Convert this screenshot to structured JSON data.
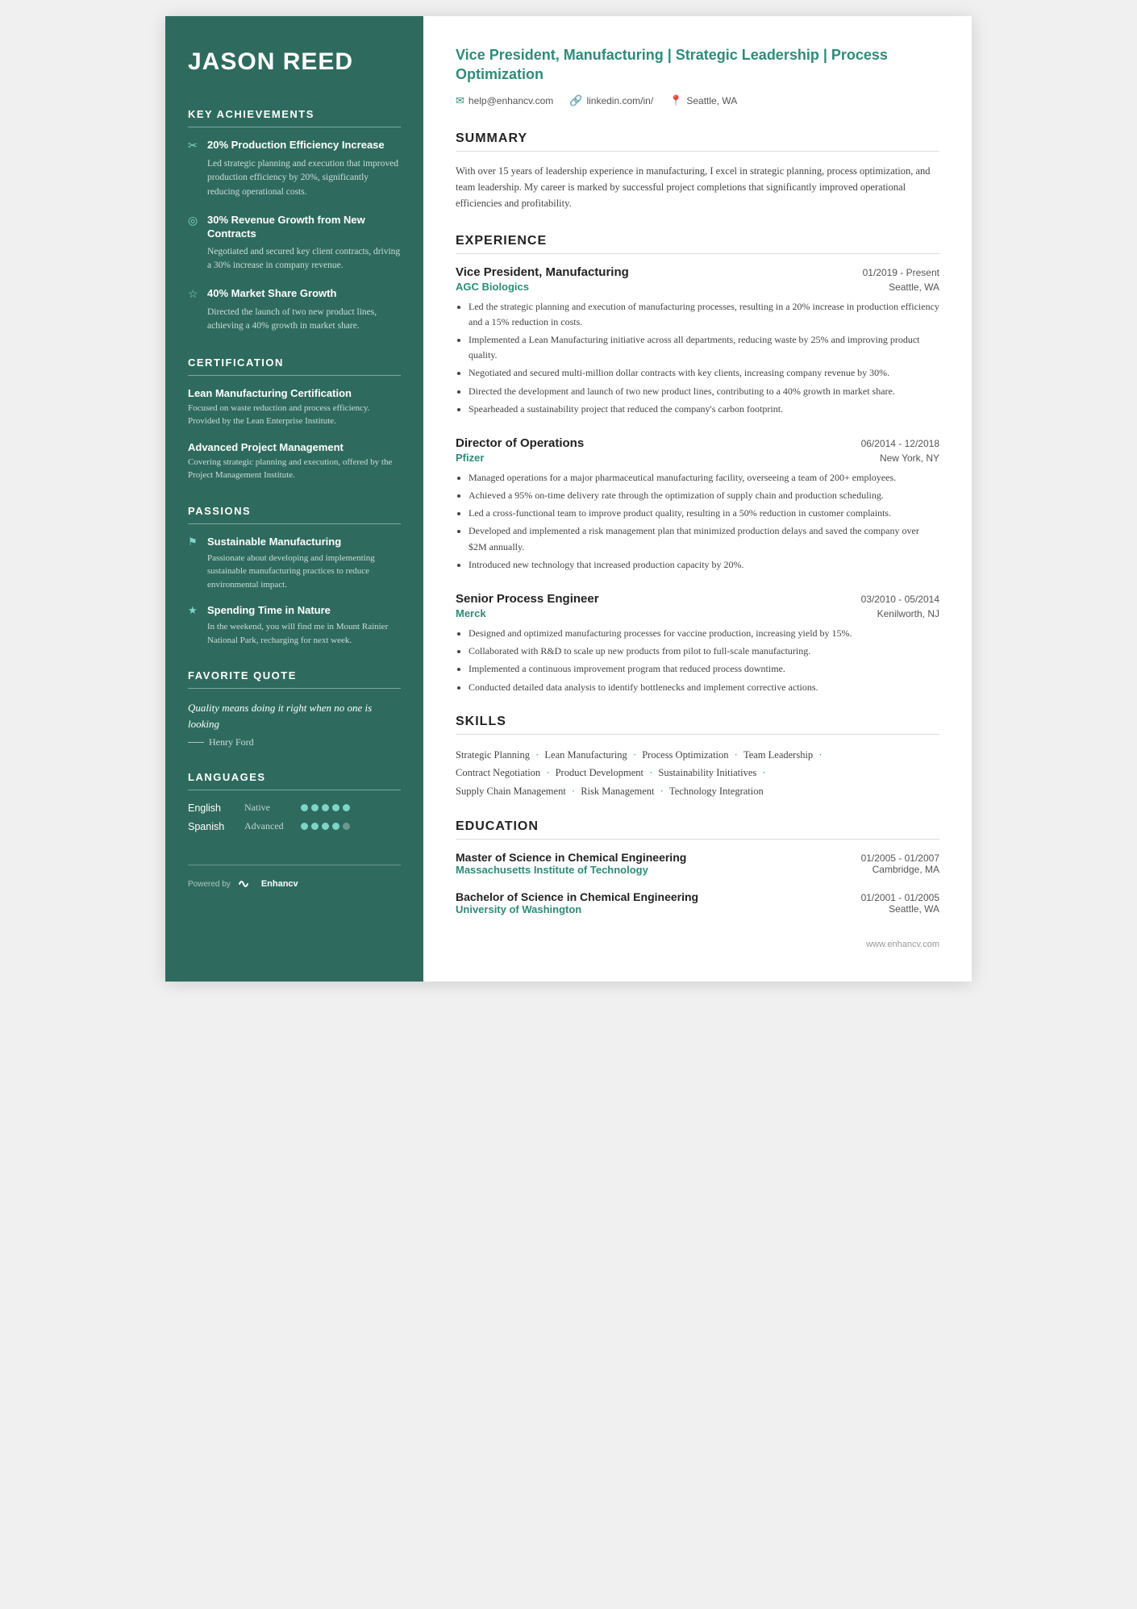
{
  "sidebar": {
    "name": "JASON REED",
    "sections": {
      "achievements_title": "KEY ACHIEVEMENTS",
      "achievements": [
        {
          "icon": "✂",
          "title": "20% Production Efficiency Increase",
          "desc": "Led strategic planning and execution that improved production efficiency by 20%, significantly reducing operational costs."
        },
        {
          "icon": "◎",
          "title": "30% Revenue Growth from New Contracts",
          "desc": "Negotiated and secured key client contracts, driving a 30% increase in company revenue."
        },
        {
          "icon": "☆",
          "title": "40% Market Share Growth",
          "desc": "Directed the launch of two new product lines, achieving a 40% growth in market share."
        }
      ],
      "certification_title": "CERTIFICATION",
      "certifications": [
        {
          "title": "Lean Manufacturing Certification",
          "desc": "Focused on waste reduction and process efficiency. Provided by the Lean Enterprise Institute."
        },
        {
          "title": "Advanced Project Management",
          "desc": "Covering strategic planning and execution, offered by the Project Management Institute."
        }
      ],
      "passions_title": "PASSIONS",
      "passions": [
        {
          "icon": "⚑",
          "title": "Sustainable Manufacturing",
          "desc": "Passionate about developing and implementing sustainable manufacturing practices to reduce environmental impact."
        },
        {
          "icon": "★",
          "title": "Spending Time in Nature",
          "desc": "In the weekend, you will find me in Mount Rainier National Park, recharging for next week."
        }
      ],
      "quote_title": "FAVORITE QUOTE",
      "quote_text": "Quality means doing it right when no one is looking",
      "quote_author": "Henry Ford",
      "languages_title": "LANGUAGES",
      "languages": [
        {
          "name": "English",
          "level": "Native",
          "filled": 5,
          "total": 5
        },
        {
          "name": "Spanish",
          "level": "Advanced",
          "filled": 4,
          "total": 5
        }
      ]
    },
    "footer": {
      "powered_by": "Powered by",
      "brand": "Enhancv"
    }
  },
  "main": {
    "headline": "Vice President, Manufacturing | Strategic Leadership | Process Optimization",
    "contact": {
      "email": "help@enhancv.com",
      "linkedin": "linkedin.com/in/",
      "location": "Seattle, WA"
    },
    "summary": {
      "title": "SUMMARY",
      "text": "With over 15 years of leadership experience in manufacturing, I excel in strategic planning, process optimization, and team leadership. My career is marked by successful project completions that significantly improved operational efficiencies and profitability."
    },
    "experience": {
      "title": "EXPERIENCE",
      "jobs": [
        {
          "title": "Vice President, Manufacturing",
          "dates": "01/2019 - Present",
          "company": "AGC Biologics",
          "location": "Seattle, WA",
          "bullets": [
            "Led the strategic planning and execution of manufacturing processes, resulting in a 20% increase in production efficiency and a 15% reduction in costs.",
            "Implemented a Lean Manufacturing initiative across all departments, reducing waste by 25% and improving product quality.",
            "Negotiated and secured multi-million dollar contracts with key clients, increasing company revenue by 30%.",
            "Directed the development and launch of two new product lines, contributing to a 40% growth in market share.",
            "Spearheaded a sustainability project that reduced the company's carbon footprint."
          ]
        },
        {
          "title": "Director of Operations",
          "dates": "06/2014 - 12/2018",
          "company": "Pfizer",
          "location": "New York, NY",
          "bullets": [
            "Managed operations for a major pharmaceutical manufacturing facility, overseeing a team of 200+ employees.",
            "Achieved a 95% on-time delivery rate through the optimization of supply chain and production scheduling.",
            "Led a cross-functional team to improve product quality, resulting in a 50% reduction in customer complaints.",
            "Developed and implemented a risk management plan that minimized production delays and saved the company over $2M annually.",
            "Introduced new technology that increased production capacity by 20%."
          ]
        },
        {
          "title": "Senior Process Engineer",
          "dates": "03/2010 - 05/2014",
          "company": "Merck",
          "location": "Kenilworth, NJ",
          "bullets": [
            "Designed and optimized manufacturing processes for vaccine production, increasing yield by 15%.",
            "Collaborated with R&D to scale up new products from pilot to full-scale manufacturing.",
            "Implemented a continuous improvement program that reduced process downtime.",
            "Conducted detailed data analysis to identify bottlenecks and implement corrective actions."
          ]
        }
      ]
    },
    "skills": {
      "title": "SKILLS",
      "items": [
        "Strategic Planning",
        "Lean Manufacturing",
        "Process Optimization",
        "Team Leadership",
        "Contract Negotiation",
        "Product Development",
        "Sustainability Initiatives",
        "Supply Chain Management",
        "Risk Management",
        "Technology Integration"
      ]
    },
    "education": {
      "title": "EDUCATION",
      "degrees": [
        {
          "degree": "Master of Science in Chemical Engineering",
          "dates": "01/2005 - 01/2007",
          "school": "Massachusetts Institute of Technology",
          "location": "Cambridge, MA"
        },
        {
          "degree": "Bachelor of Science in Chemical Engineering",
          "dates": "01/2001 - 01/2005",
          "school": "University of Washington",
          "location": "Seattle, WA"
        }
      ]
    },
    "footer": {
      "url": "www.enhancv.com"
    }
  }
}
